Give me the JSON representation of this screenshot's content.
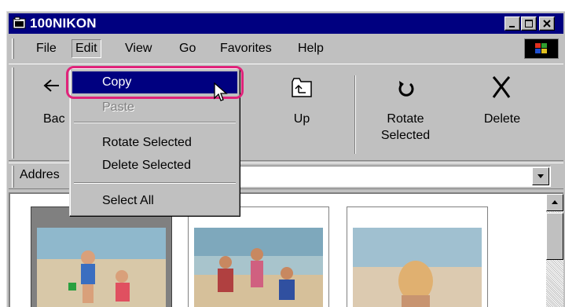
{
  "window": {
    "title": "100NIKON"
  },
  "menubar": {
    "items": [
      {
        "label": "File",
        "accel": "F"
      },
      {
        "label": "Edit",
        "accel": "E"
      },
      {
        "label": "View",
        "accel": "V"
      },
      {
        "label": "Go",
        "accel": "G"
      },
      {
        "label": "Favorites",
        "accel": "a"
      },
      {
        "label": "Help",
        "accel": "H"
      }
    ]
  },
  "toolbar": {
    "back": "Bac",
    "up": "Up",
    "rotate_line1": "Rotate",
    "rotate_line2": "Selected",
    "delete": "Delete"
  },
  "address": {
    "label": "Addres",
    "value": ""
  },
  "edit_menu": {
    "items": [
      {
        "label": "Copy",
        "state": "highlighted"
      },
      {
        "label": "Paste",
        "state": "disabled"
      },
      {
        "label": "Rotate Selected",
        "state": "normal"
      },
      {
        "label": "Delete Selected",
        "state": "normal"
      },
      {
        "label": "Select All",
        "state": "normal"
      }
    ]
  },
  "colors": {
    "title_bar": "#000080",
    "menu_highlight": "#000080",
    "callout": "#e0237a",
    "face": "#c0c0c0"
  },
  "icons": [
    "folder-icon",
    "minimize-icon",
    "maximize-icon",
    "close-icon",
    "windows-logo-icon",
    "back-arrow-icon",
    "up-folder-icon",
    "rotate-icon",
    "delete-x-icon",
    "dropdown-arrow-icon",
    "scroll-up-arrow-icon",
    "pointer-cursor-icon"
  ]
}
